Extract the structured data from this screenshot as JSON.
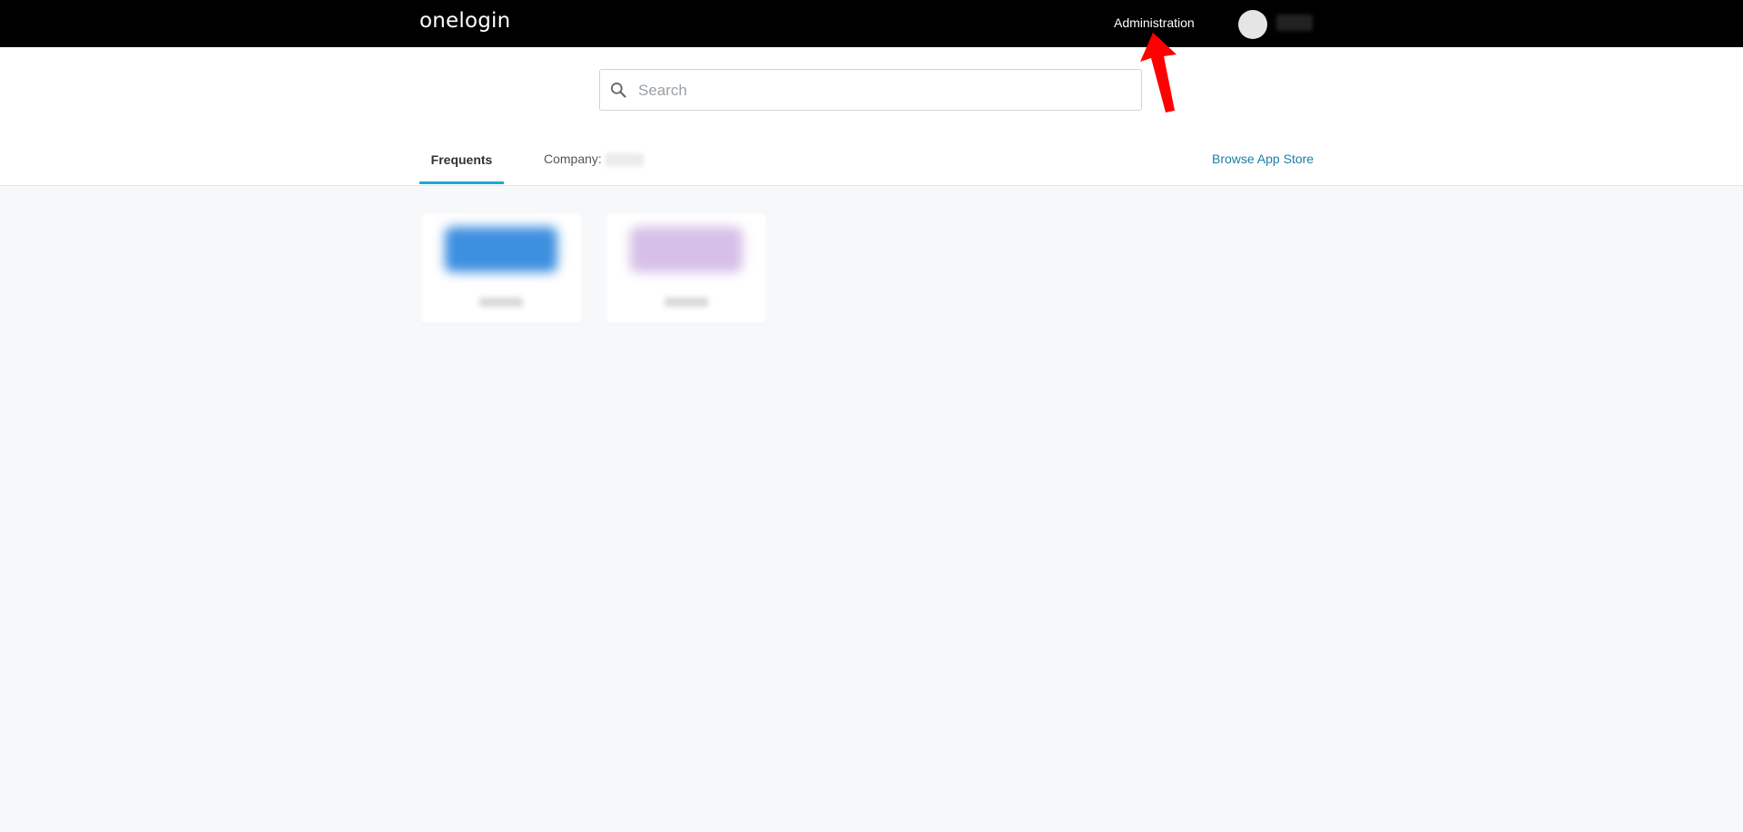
{
  "header": {
    "logo_text": "onelogin",
    "administration_label": "Administration",
    "avatar_icon": "user-avatar",
    "background_color": "#000000"
  },
  "search": {
    "placeholder": "Search",
    "icon": "search-icon"
  },
  "tabs": {
    "frequents_label": "Frequents",
    "company_label": "Company:",
    "accent_color": "#1fa8d1"
  },
  "browse_app_store_label": "Browse App Store",
  "apps": [
    {
      "logo_color": "#3d8fe0"
    },
    {
      "logo_color": "#b58ad6"
    }
  ],
  "annotation": {
    "arrow_color": "#ff0000"
  }
}
